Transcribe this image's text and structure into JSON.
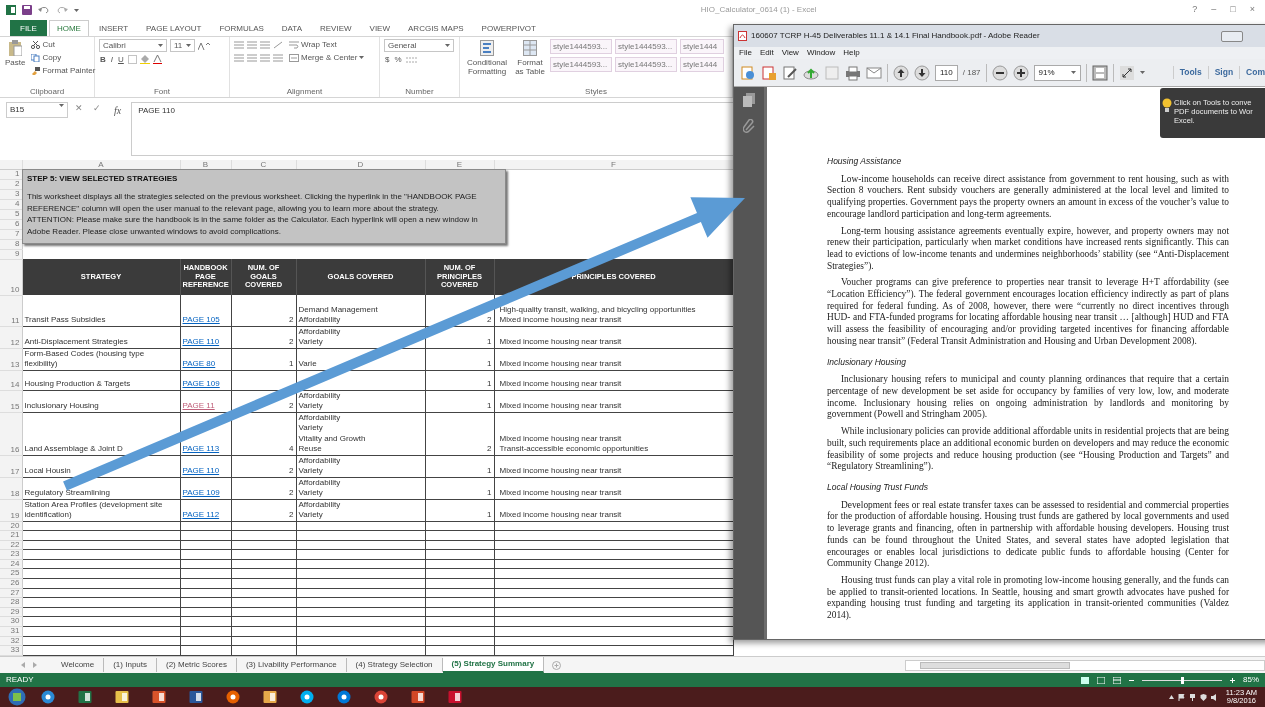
{
  "excel": {
    "title": "HIO_Calculator_0614 (1) - Excel",
    "window_controls": [
      "?",
      "–",
      "□",
      "×"
    ],
    "ribbon_tabs": [
      {
        "label": "FILE",
        "kind": "file",
        "selected": false
      },
      {
        "label": "HOME",
        "kind": "tab",
        "selected": true
      },
      {
        "label": "INSERT",
        "kind": "tab",
        "selected": false
      },
      {
        "label": "PAGE LAYOUT",
        "kind": "tab",
        "selected": false
      },
      {
        "label": "FORMULAS",
        "kind": "tab",
        "selected": false
      },
      {
        "label": "DATA",
        "kind": "tab",
        "selected": false
      },
      {
        "label": "REVIEW",
        "kind": "tab",
        "selected": false
      },
      {
        "label": "VIEW",
        "kind": "tab",
        "selected": false
      },
      {
        "label": "ARCGIS MAPS",
        "kind": "tab",
        "selected": false
      },
      {
        "label": "POWERPIVOT",
        "kind": "tab",
        "selected": false
      }
    ],
    "clipboard": {
      "label": "Clipboard",
      "paste": "Paste",
      "cut": "Cut",
      "copy": "Copy",
      "format_painter": "Format Painter"
    },
    "font": {
      "label": "Font",
      "name": "Calibri",
      "size": "11",
      "buttons": [
        "B",
        "I",
        "U"
      ]
    },
    "alignment": {
      "label": "Alignment",
      "wrap_text": "Wrap Text",
      "merge_center": "Merge & Center"
    },
    "number": {
      "label": "Number",
      "format": "General",
      "buttons": [
        "$",
        "%"
      ]
    },
    "styles": {
      "label": "Styles",
      "conditional_formatting": "Conditional Formatting",
      "format_as_table": "Format as Table",
      "cell_styles": [
        "style1444593...",
        "style1444593...",
        "style1444",
        "style1444593...",
        "style1444593...",
        "style1444"
      ]
    },
    "formula_bar": {
      "name_box": "B15",
      "cancel": "✕",
      "enter": "✓",
      "fx": "fx",
      "content": "PAGE 110"
    },
    "column_headers": [
      "A",
      "B",
      "C",
      "D",
      "E",
      "F"
    ],
    "top_rows": [
      "1",
      "2",
      "3",
      "4",
      "5",
      "6",
      "7",
      "8",
      "9"
    ],
    "text_box": {
      "title": "STEP 5: VIEW SELECTED STRATEGIES",
      "paragraphs": [
        "This worksheet displays all the strategies selected on the previous worksheet.  Clicking the hyperlink in the \"HANDBOOK PAGE REFERENCE\" column will open the user manual to the relevant page, allowing you to learn more about the strategy.",
        "ATTENTION: Please make sure the handbook is in the same folder as the Calculator. Each hyperlink will open a new window in Adobe Reader. Please close unwanted windows to avoid complications."
      ]
    },
    "table": {
      "header_row": "10",
      "columns": [
        "STRATEGY",
        "HANDBOOK PAGE REFERENCE",
        "NUM. OF GOALS COVERED",
        "GOALS COVERED",
        "NUM. OF PRINCIPLES COVERED",
        "PRINCIPLES COVERED"
      ],
      "rows": [
        {
          "number": "11",
          "strategy": "Transit Pass Subsidies",
          "page_ref": "PAGE 105",
          "visited": false,
          "goals_count": "2",
          "goals": [
            "Demand Management",
            "Affordability"
          ],
          "principles_count": "2",
          "principles": [
            "High-quality transit, walking, and bicycling opportunities",
            "Mixed income housing near transit"
          ]
        },
        {
          "number": "12",
          "strategy": "Anti-Displacement Strategies",
          "page_ref": "PAGE 110",
          "visited": false,
          "goals_count": "2",
          "goals": [
            "Affordability",
            "Variety"
          ],
          "principles_count": "1",
          "principles": [
            "Mixed income housing near transit"
          ]
        },
        {
          "number": "13",
          "strategy": "Form-Based Codes (housing type flexibility)",
          "page_ref": "PAGE 80",
          "visited": false,
          "goals_count": "1",
          "goals": [
            "Varie"
          ],
          "principles_count": "1",
          "principles": [
            "Mixed income housing near transit"
          ]
        },
        {
          "number": "14",
          "strategy": "Housing Production & Targets",
          "page_ref": "PAGE 109",
          "visited": false,
          "principles_count": "1",
          "principles": [
            "Mixed income housing near transit"
          ]
        },
        {
          "number": "15",
          "strategy": "Inclusionary Housing",
          "page_ref": "PAGE 11",
          "visited": true,
          "goals_count": "2",
          "goals": [
            "Affordability",
            "Variety"
          ],
          "principles_count": "1",
          "principles": [
            "Mixed income housing near transit"
          ]
        },
        {
          "number": "16",
          "strategy": "Land Assemblage & Joint D",
          "page_ref": "PAGE 113",
          "visited": false,
          "goals_count": "4",
          "goals": [
            "Affordability",
            "Variety",
            "Vitality and Growth",
            "Reuse"
          ],
          "principles_count": "2",
          "principles": [
            "Mixed income housing near transit",
            "Transit-accessible economic opportunities"
          ]
        },
        {
          "number": "17",
          "strategy": "Local Housin",
          "page_ref": "PAGE 110",
          "visited": false,
          "goals_count": "2",
          "goals": [
            "Affordability",
            "Variety"
          ],
          "principles_count": "1",
          "principles": [
            "Mixed income housing near transit"
          ]
        },
        {
          "number": "18",
          "strategy": "Regulatory Streamlining",
          "page_ref": "PAGE 109",
          "visited": false,
          "goals_count": "2",
          "goals": [
            "Affordability",
            "Variety"
          ],
          "principles_count": "1",
          "principles": [
            "Mixed income housing near transit"
          ]
        },
        {
          "number": "19",
          "strategy": "Station Area Profiles (development site identification)",
          "page_ref": "PAGE 112",
          "visited": false,
          "goals_count": "2",
          "goals": [
            "Affordability",
            "Variety"
          ],
          "principles_count": "1",
          "principles": [
            "Mixed income housing near transit"
          ]
        }
      ]
    },
    "empty_rows": [
      "20",
      "21",
      "22",
      "23",
      "24",
      "25",
      "26",
      "27",
      "28",
      "29",
      "30",
      "31",
      "32",
      "33"
    ],
    "sheet_tabs": [
      {
        "label": "Welcome",
        "selected": false
      },
      {
        "label": "(1) Inputs",
        "selected": false
      },
      {
        "label": "(2) Metric Scores",
        "selected": false
      },
      {
        "label": "(3) Livability Performance",
        "selected": false
      },
      {
        "label": "(4) Strategy Selection",
        "selected": false
      },
      {
        "label": "(5) Strategy Summary",
        "selected": true
      }
    ],
    "status_bar": {
      "status": "READY",
      "zoom_slider": {
        "level": 0.5
      },
      "zoom": "85%"
    }
  },
  "pdf": {
    "title": "160607 TCRP H-45 Deliverables 11.1 & 14.1 Final  Handbook.pdf - Adobe Reader",
    "menu": [
      "File",
      "Edit",
      "View",
      "Window",
      "Help"
    ],
    "page_number": "110",
    "page_total": "/ 187",
    "zoom": "91%",
    "panes": [
      "Tools",
      "Sign",
      "Com"
    ],
    "tooltip": [
      "Click on Tools to conve",
      "PDF documents to Wor",
      "Excel."
    ],
    "sections": [
      {
        "heading": "Housing Assistance",
        "paragraphs": [
          "Low-income households can receive direct assistance from government to rent housing, such as with Section 8 vouchers. Rent subsidy vouchers are generally administered at the local level and limited to qualifying properties. Government pays the property owners an amount in excess of the voucher’s value to encourage landlord participation and long-term agreements.",
          "Long-term housing assistance agreements eventually expire, however, and property owners may not renew their participation, particularly when market conditions have increased rents significantly. This can lead to evictions of low-income tenants and undermines neighborhoods’ stability (see “Anti-Displacement Strategies”).",
          "Voucher programs can give preference to properties near transit to leverage H+T affordability (see “Location Efficiency”). The federal government encourages location efficiency indirectly as part of plans required for federal funding. As of 2008, however, there were “currently no direct incentives through HUD- and FTA-funded programs for locating affordable housing near transit … [although] HUD and FTA will assess the feasibility of encouraging and/or providing targeted incentives for financing affordable housing near transit” (Federal Transit Administration and Housing and Urban Development 2008)."
        ]
      },
      {
        "heading": "Inclusionary Housing",
        "paragraphs": [
          "Inclusionary housing refers to municipal and county planning ordinances that require that a certain percentage of new development be set aside for occupancy by families of very low, low, and moderate income. Inclusionary housing relies on ongoing administration by landlords and monitoring by government (Powell and Stringham 2005).",
          "While inclusionary policies can provide additional affordable units in residential projects that are being built, such requirements place an additional economic burden on developers and may reduce the economic feasibility of some projects and reduce housing production (see “Housing Production and Targets” and “Regulatory Streamlining”)."
        ]
      },
      {
        "heading": "Local Housing Trust Funds",
        "paragraphs": [
          "Development fees or real estate transfer taxes can be assessed to residential and commercial properties for the production of affordable housing. Housing trust funds are gathered by local governments and used to leverage grants and financing, often in partnership with affordable housing developers. Housing trust funds can be found throughout the United States, and several states have adopted legislation that encourages or enables local jurisdictions to dedicate public funds to affordable housing (Center for Community Change 2012).",
          "Housing trust funds can play a vital role in promoting low-income housing generally, and the funds can be applied to transit-oriented locations. In Seattle, housing and smart growth advocates have pushed for expanding housing trust funding and targeting its application in transit-oriented communities (Valdez 2014)."
        ]
      }
    ]
  },
  "taskbar": {
    "time": "11:23 AM",
    "date": "9/8/2016"
  }
}
